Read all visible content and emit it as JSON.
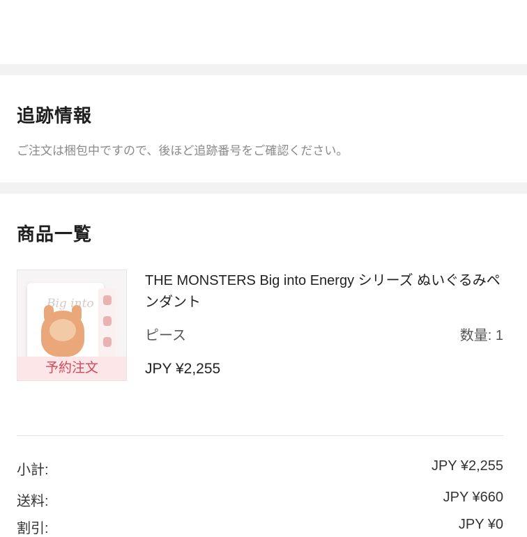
{
  "tracking": {
    "title": "追跡情報",
    "message": "ご注文は梱包中ですので、後ほど追跡番号をご確認ください。"
  },
  "products": {
    "title": "商品一覧",
    "items": [
      {
        "name": "THE MONSTERS Big into Energy シリーズ ぬいぐるみペンダント",
        "badge": "予約注文",
        "variant": "ピース",
        "quantity": "数量: 1",
        "price": "JPY ¥2,255",
        "thumbnail_icon": "product-box-image"
      }
    ]
  },
  "summary": [
    {
      "label": "小計:",
      "value": "JPY ¥2,255"
    },
    {
      "label": "送料:",
      "value": "JPY ¥660"
    },
    {
      "label": "割引:",
      "value": "JPY ¥0"
    }
  ],
  "colors": {
    "section_gap": "#f2f2f2",
    "badge_bg": "#fde6e8",
    "badge_text": "#d54859",
    "muted_text": "#8a8a8a"
  }
}
